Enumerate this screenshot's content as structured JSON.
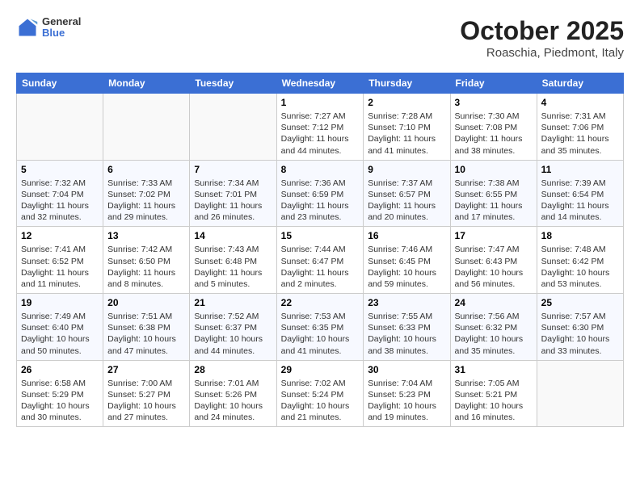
{
  "header": {
    "logo": {
      "general": "General",
      "blue": "Blue"
    },
    "month": "October 2025",
    "location": "Roaschia, Piedmont, Italy"
  },
  "days_of_week": [
    "Sunday",
    "Monday",
    "Tuesday",
    "Wednesday",
    "Thursday",
    "Friday",
    "Saturday"
  ],
  "weeks": [
    [
      {
        "day": "",
        "info": ""
      },
      {
        "day": "",
        "info": ""
      },
      {
        "day": "",
        "info": ""
      },
      {
        "day": "1",
        "info": "Sunrise: 7:27 AM\nSunset: 7:12 PM\nDaylight: 11 hours and 44 minutes."
      },
      {
        "day": "2",
        "info": "Sunrise: 7:28 AM\nSunset: 7:10 PM\nDaylight: 11 hours and 41 minutes."
      },
      {
        "day": "3",
        "info": "Sunrise: 7:30 AM\nSunset: 7:08 PM\nDaylight: 11 hours and 38 minutes."
      },
      {
        "day": "4",
        "info": "Sunrise: 7:31 AM\nSunset: 7:06 PM\nDaylight: 11 hours and 35 minutes."
      }
    ],
    [
      {
        "day": "5",
        "info": "Sunrise: 7:32 AM\nSunset: 7:04 PM\nDaylight: 11 hours and 32 minutes."
      },
      {
        "day": "6",
        "info": "Sunrise: 7:33 AM\nSunset: 7:02 PM\nDaylight: 11 hours and 29 minutes."
      },
      {
        "day": "7",
        "info": "Sunrise: 7:34 AM\nSunset: 7:01 PM\nDaylight: 11 hours and 26 minutes."
      },
      {
        "day": "8",
        "info": "Sunrise: 7:36 AM\nSunset: 6:59 PM\nDaylight: 11 hours and 23 minutes."
      },
      {
        "day": "9",
        "info": "Sunrise: 7:37 AM\nSunset: 6:57 PM\nDaylight: 11 hours and 20 minutes."
      },
      {
        "day": "10",
        "info": "Sunrise: 7:38 AM\nSunset: 6:55 PM\nDaylight: 11 hours and 17 minutes."
      },
      {
        "day": "11",
        "info": "Sunrise: 7:39 AM\nSunset: 6:54 PM\nDaylight: 11 hours and 14 minutes."
      }
    ],
    [
      {
        "day": "12",
        "info": "Sunrise: 7:41 AM\nSunset: 6:52 PM\nDaylight: 11 hours and 11 minutes."
      },
      {
        "day": "13",
        "info": "Sunrise: 7:42 AM\nSunset: 6:50 PM\nDaylight: 11 hours and 8 minutes."
      },
      {
        "day": "14",
        "info": "Sunrise: 7:43 AM\nSunset: 6:48 PM\nDaylight: 11 hours and 5 minutes."
      },
      {
        "day": "15",
        "info": "Sunrise: 7:44 AM\nSunset: 6:47 PM\nDaylight: 11 hours and 2 minutes."
      },
      {
        "day": "16",
        "info": "Sunrise: 7:46 AM\nSunset: 6:45 PM\nDaylight: 10 hours and 59 minutes."
      },
      {
        "day": "17",
        "info": "Sunrise: 7:47 AM\nSunset: 6:43 PM\nDaylight: 10 hours and 56 minutes."
      },
      {
        "day": "18",
        "info": "Sunrise: 7:48 AM\nSunset: 6:42 PM\nDaylight: 10 hours and 53 minutes."
      }
    ],
    [
      {
        "day": "19",
        "info": "Sunrise: 7:49 AM\nSunset: 6:40 PM\nDaylight: 10 hours and 50 minutes."
      },
      {
        "day": "20",
        "info": "Sunrise: 7:51 AM\nSunset: 6:38 PM\nDaylight: 10 hours and 47 minutes."
      },
      {
        "day": "21",
        "info": "Sunrise: 7:52 AM\nSunset: 6:37 PM\nDaylight: 10 hours and 44 minutes."
      },
      {
        "day": "22",
        "info": "Sunrise: 7:53 AM\nSunset: 6:35 PM\nDaylight: 10 hours and 41 minutes."
      },
      {
        "day": "23",
        "info": "Sunrise: 7:55 AM\nSunset: 6:33 PM\nDaylight: 10 hours and 38 minutes."
      },
      {
        "day": "24",
        "info": "Sunrise: 7:56 AM\nSunset: 6:32 PM\nDaylight: 10 hours and 35 minutes."
      },
      {
        "day": "25",
        "info": "Sunrise: 7:57 AM\nSunset: 6:30 PM\nDaylight: 10 hours and 33 minutes."
      }
    ],
    [
      {
        "day": "26",
        "info": "Sunrise: 6:58 AM\nSunset: 5:29 PM\nDaylight: 10 hours and 30 minutes."
      },
      {
        "day": "27",
        "info": "Sunrise: 7:00 AM\nSunset: 5:27 PM\nDaylight: 10 hours and 27 minutes."
      },
      {
        "day": "28",
        "info": "Sunrise: 7:01 AM\nSunset: 5:26 PM\nDaylight: 10 hours and 24 minutes."
      },
      {
        "day": "29",
        "info": "Sunrise: 7:02 AM\nSunset: 5:24 PM\nDaylight: 10 hours and 21 minutes."
      },
      {
        "day": "30",
        "info": "Sunrise: 7:04 AM\nSunset: 5:23 PM\nDaylight: 10 hours and 19 minutes."
      },
      {
        "day": "31",
        "info": "Sunrise: 7:05 AM\nSunset: 5:21 PM\nDaylight: 10 hours and 16 minutes."
      },
      {
        "day": "",
        "info": ""
      }
    ]
  ]
}
